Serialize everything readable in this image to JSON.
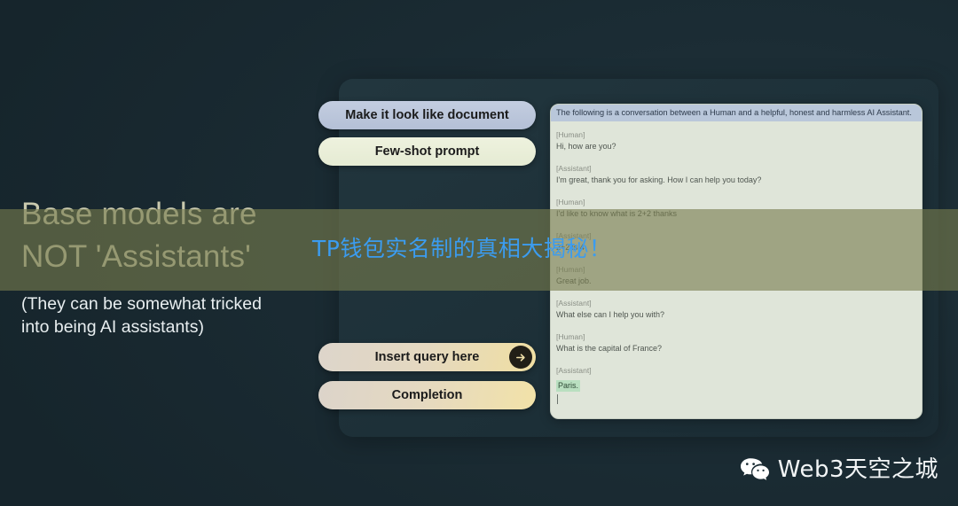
{
  "slide": {
    "background_color": "#16262e",
    "headline_lines": [
      "Base models are",
      "NOT 'Assistants'"
    ],
    "headline_color": "#c9c9ae",
    "subtitle": "(They can be somewhat tricked\ninto being AI assistants)",
    "subtitle_line_1": "(They can be somewhat tricked",
    "subtitle_line_2": "into being AI assistants)"
  },
  "pills": {
    "make_document": {
      "label": "Make it look like document",
      "color": "#b9c6d8"
    },
    "few_shot": {
      "label": "Few-shot prompt",
      "color": "#e8eed6"
    },
    "insert_query": {
      "label": "Insert query here",
      "color": "#e6d8b8",
      "arrow_icon": "arrow-right-icon"
    },
    "completion": {
      "label": "Completion",
      "color": "#e6dab8"
    }
  },
  "chat": {
    "system_line": "The following is a conversation between a Human and a helpful, honest and harmless AI Assistant.",
    "system_highlight_color": "#b9c7da",
    "panel_background": "#dfe5d9",
    "answer_highlight_color": "#b9dfc0",
    "turns": [
      {
        "role": "[Human]",
        "text": "Hi, how are you?",
        "highlight": false
      },
      {
        "role": "[Assistant]",
        "text": "I'm great, thank you for asking. How I can help you today?",
        "highlight": false
      },
      {
        "role": "[Human]",
        "text": "I'd like to know what is 2+2 thanks",
        "highlight": false
      },
      {
        "role": "[Assistant]",
        "text": "2+2 is 4",
        "highlight": false
      },
      {
        "role": "[Human]",
        "text": "Great job.",
        "highlight": false
      },
      {
        "role": "[Assistant]",
        "text": "What else can I help you with?",
        "highlight": false
      },
      {
        "role": "[Human]",
        "text": "What is the capital of France?",
        "highlight": false
      },
      {
        "role": "[Assistant]",
        "text": "Paris.",
        "highlight": true
      }
    ]
  },
  "overlay": {
    "band_color": "rgba(119,124,77,.62)",
    "caption": "TP钱包实名制的真相大揭秘！",
    "caption_color": "#3b9cf0"
  },
  "watermark": {
    "label": "Web3天空之城",
    "icon": "wechat-icon",
    "color": "#f2f5f6"
  }
}
